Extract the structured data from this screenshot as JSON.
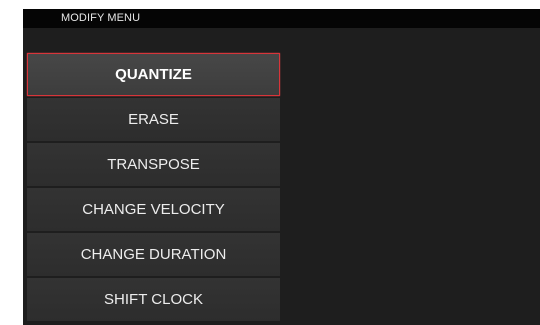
{
  "window": {
    "title": "MODIFY MENU"
  },
  "menu": {
    "selected_index": 0,
    "accent_color": "#d8353a",
    "items": [
      {
        "label": "QUANTIZE"
      },
      {
        "label": "ERASE"
      },
      {
        "label": "TRANSPOSE"
      },
      {
        "label": "CHANGE VELOCITY"
      },
      {
        "label": "CHANGE DURATION"
      },
      {
        "label": "SHIFT CLOCK"
      }
    ]
  }
}
